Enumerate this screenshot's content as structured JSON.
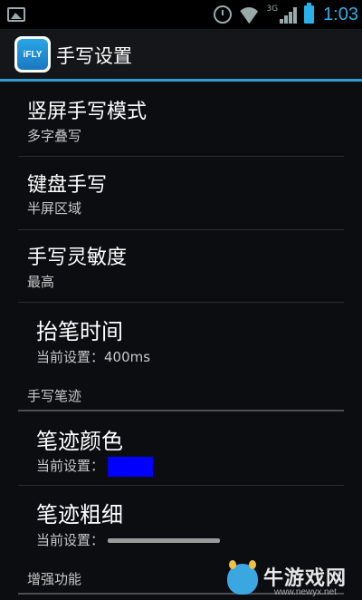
{
  "status_bar": {
    "network_type": "3G",
    "time": "1:03"
  },
  "action_bar": {
    "logo_text": "iFLY",
    "title": "手写设置"
  },
  "settings": {
    "portrait_mode": {
      "title": "竖屏手写模式",
      "summary": "多字叠写"
    },
    "keyboard_handwriting": {
      "title": "键盘手写",
      "summary": "半屏区域"
    },
    "sensitivity": {
      "title": "手写灵敏度",
      "summary": "最高"
    },
    "pen_lift_time": {
      "title": "抬笔时间",
      "summary": "当前设置：400ms"
    },
    "stroke_category": {
      "label": "手写笔迹"
    },
    "stroke_color": {
      "title": "笔迹颜色",
      "summary_prefix": "当前设置：",
      "value_color": "#0000ff"
    },
    "stroke_thickness": {
      "title": "笔迹粗细",
      "summary_prefix": "当前设置：",
      "value_fraction": 0.3
    },
    "enhanced_category": {
      "label": "增强功能"
    }
  },
  "watermark": {
    "text": "牛游戏网",
    "url": "www.newyx.net"
  },
  "colors": {
    "accent": "#2f9fd4",
    "clock": "#2ab0e8"
  }
}
